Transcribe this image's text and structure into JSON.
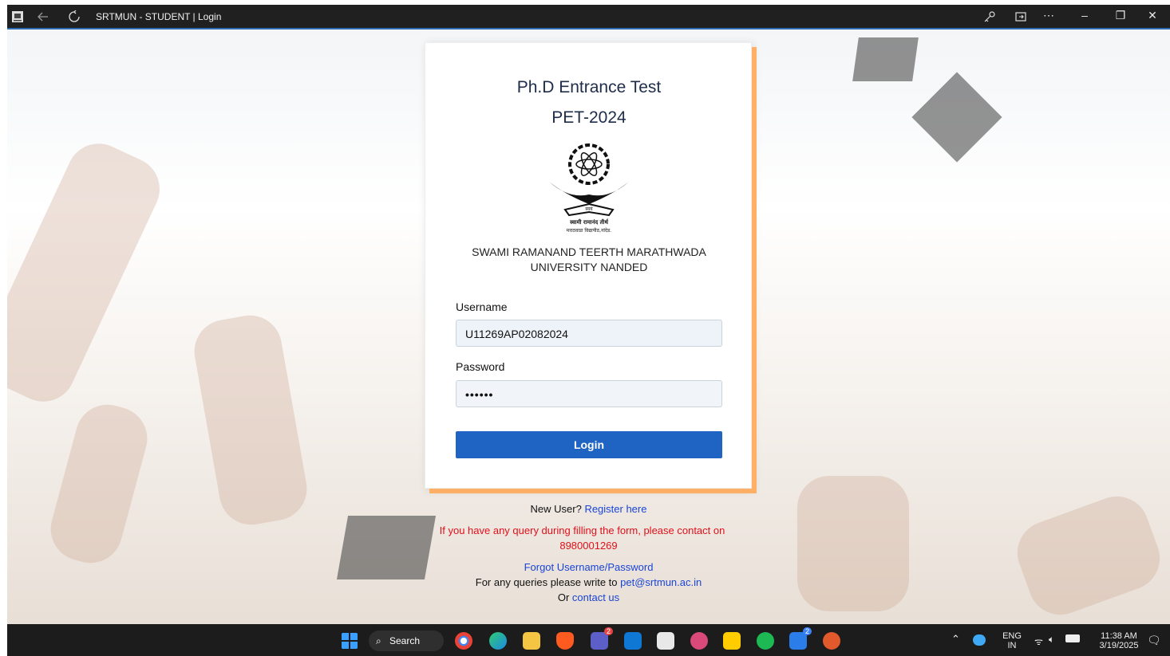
{
  "window": {
    "title": "SRTMUN - STUDENT | Login",
    "controls": [
      "more-icon",
      "minimize-icon",
      "maximize-icon",
      "close-icon"
    ]
  },
  "card": {
    "heading": "Ph.D Entrance Test",
    "subheading": "PET-2024",
    "logo_text_line1": "स्वामी रामानंद तीर्थ",
    "logo_text_line2": "मराठवाडा विद्यापीठ,नांदेड.",
    "university_line1": "SWAMI RAMANAND TEERTH MARATHWADA",
    "university_line2": "UNIVERSITY NANDED",
    "username_label": "Username",
    "username_value": "U11269AP02082024",
    "password_label": "Password",
    "password_value": "••••••",
    "login_button": "Login"
  },
  "footer": {
    "new_user_prefix": "New User?",
    "register_link": "Register here",
    "query_line1": "If you have any query during filling the form, please contact on",
    "query_phone": "8980001269",
    "forgot_link": "Forgot Username/Password",
    "email_prefix": "For any queries please write to",
    "email_link": "pet@srtmun.ac.in",
    "or_prefix": "Or",
    "contact_link": "contact us"
  },
  "taskbar": {
    "search_label": "Search",
    "teams_badge": "2",
    "app_badge": "2",
    "lang_line1": "ENG",
    "lang_line2": "IN",
    "time": "11:38 AM",
    "date": "3/19/2025"
  },
  "colors": {
    "accent": "#1f64c2",
    "card_shadow": "#ffb066",
    "link": "#1a44d6",
    "warning": "#e0101a",
    "heading": "#1e2d4a"
  }
}
